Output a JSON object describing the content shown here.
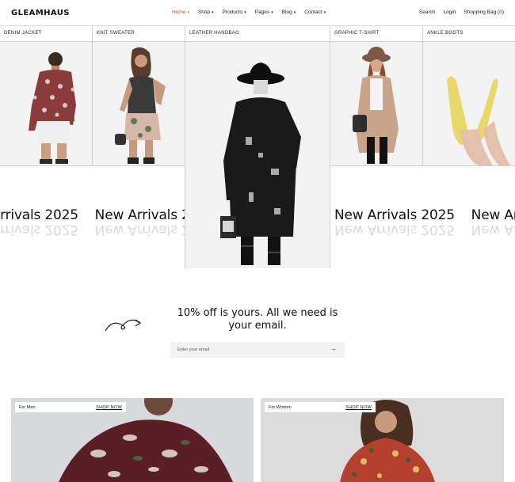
{
  "brand": {
    "logo": "GLEAMHAUS"
  },
  "nav": {
    "items": [
      {
        "label": "Home",
        "active": true
      },
      {
        "label": "Shop",
        "active": false
      },
      {
        "label": "Products",
        "active": false
      },
      {
        "label": "Pages",
        "active": false
      },
      {
        "label": "Blog",
        "active": false
      },
      {
        "label": "Contact",
        "active": false
      }
    ],
    "caret": "▾"
  },
  "utility": {
    "search": "Search",
    "login": "Login",
    "bag": "Shopping Bag (0)"
  },
  "categories": {
    "denim": "DENIM JACKET",
    "sweater": "KNIT SWEATER",
    "handbag": "LEATHER HANDBAG",
    "tshirt": "GRAPHIC T-SHIRT",
    "boots": "ANKLE BOOTS"
  },
  "banner": {
    "text": "New Arrivals 2025"
  },
  "newsletter": {
    "title": "10% off is yours. All we need is your email.",
    "placeholder": "Enter your email",
    "submit_icon": "→"
  },
  "promos": [
    {
      "tag": "For Men",
      "cta": "SHOP NOW"
    },
    {
      "tag": "For Women",
      "cta": "SHOP NOW"
    }
  ],
  "colors": {
    "accent": "#e0492b",
    "panel": "#f3f3f3"
  }
}
